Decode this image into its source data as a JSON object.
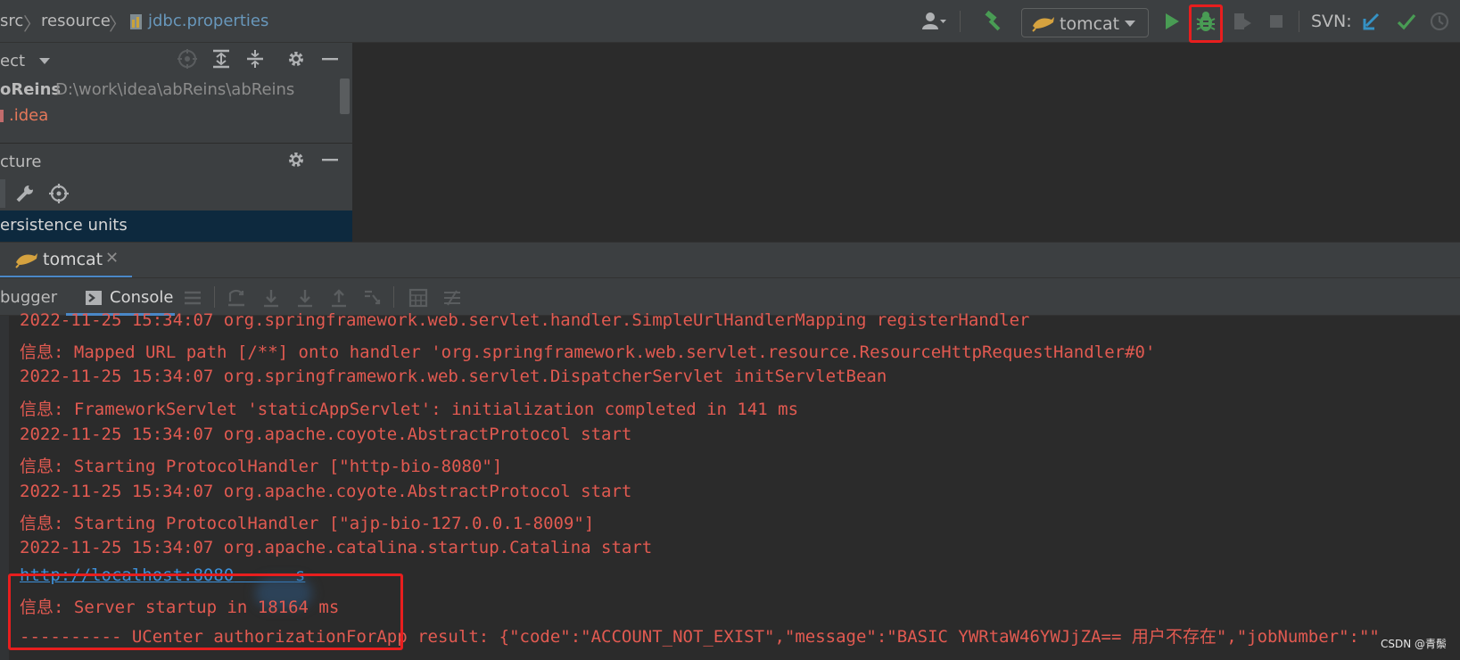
{
  "navbar": {
    "breadcrumbs": [
      "src",
      "resource",
      "jdbc.properties"
    ],
    "run_config_label": "tomcat",
    "svn_label": "SVN:"
  },
  "project_panel": {
    "title": "ect",
    "root_name": "oReins",
    "root_path": "D:\\work\\idea\\abReins\\abReins",
    "idea_folder": ".idea"
  },
  "structure_panel": {
    "title": "cture",
    "selected_item": "ersistence units"
  },
  "run_window": {
    "tab_label": "tomcat",
    "debugger_tab": "bugger",
    "console_tab": "Console"
  },
  "console": {
    "lines": [
      "2022-11-25 15:34:07 org.springframework.web.servlet.handler.SimpleUrlHandlerMapping registerHandler",
      "信息: Mapped URL path [/**] onto handler 'org.springframework.web.servlet.resource.ResourceHttpRequestHandler#0'",
      "2022-11-25 15:34:07 org.springframework.web.servlet.DispatcherServlet initServletBean",
      "信息: FrameworkServlet 'staticAppServlet': initialization completed in 141 ms",
      "2022-11-25 15:34:07 org.apache.coyote.AbstractProtocol start",
      "信息: Starting ProtocolHandler [\"http-bio-8080\"]",
      "2022-11-25 15:34:07 org.apache.coyote.AbstractProtocol start",
      "信息: Starting ProtocolHandler [\"ajp-bio-127.0.0.1-8009\"]",
      "2022-11-25 15:34:07 org.apache.catalina.startup.Catalina start"
    ],
    "link_start": "http://localhost:8080",
    "link_end": "s",
    "startup_line": "信息: Server startup in 18164 ms",
    "last_line": "---------- UCenter authorizationForApp result: {\"code\":\"ACCOUNT_NOT_EXIST\",\"message\":\"BASIC YWRtaW46YWJjZA== 用户不存在\",\"jobNumber\":\"\""
  },
  "watermark": "CSDN @青鬃",
  "colors": {
    "log_text": "#e25a51",
    "link": "#3d8fd8",
    "highlight": "#e81e1e",
    "accent_tab": "#4a88c7",
    "run_green": "#499c54"
  },
  "icons": [
    "user-icon",
    "build-hammer-icon",
    "tomcat-icon",
    "run-icon",
    "debug-icon",
    "coverage-icon",
    "stop-icon",
    "svn-update-icon",
    "svn-commit-icon",
    "svn-history-icon"
  ]
}
